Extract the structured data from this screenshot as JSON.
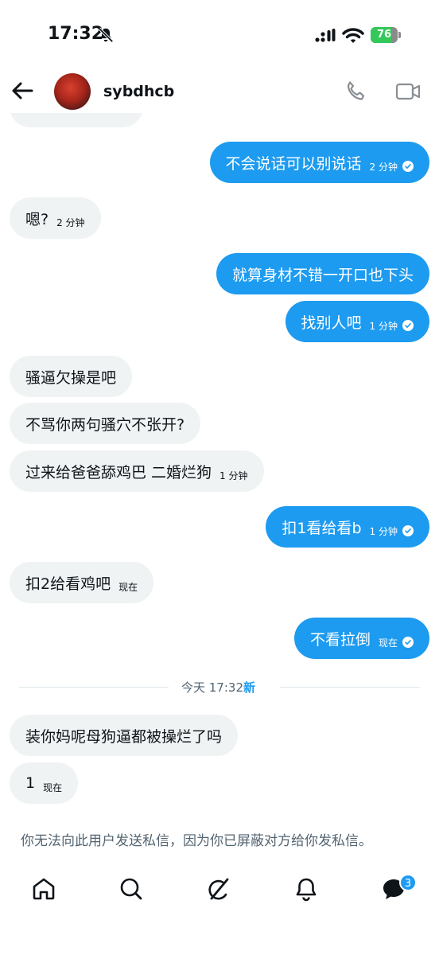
{
  "status": {
    "time": "17:32",
    "battery": "76"
  },
  "header": {
    "username": "sybdhcb"
  },
  "messages": [
    {
      "side": "right",
      "text": "不会说话可以别说话",
      "time": "2 分钟",
      "read": true
    },
    {
      "side": "left",
      "text": "嗯?",
      "time": "2 分钟"
    },
    {
      "side": "right",
      "text": "就算身材不错一开口也下头",
      "time": "",
      "read": false
    },
    {
      "side": "right",
      "text": "找别人吧",
      "time": "1 分钟",
      "read": true
    },
    {
      "side": "left",
      "text": "骚逼欠操是吧",
      "time": ""
    },
    {
      "side": "left",
      "text": "不骂你两句骚穴不张开?",
      "time": ""
    },
    {
      "side": "left",
      "text": "过来给爸爸舔鸡巴 二婚烂狗",
      "time": "1 分钟"
    },
    {
      "side": "right",
      "text": "扣1看给看b",
      "time": "1 分钟",
      "read": true
    },
    {
      "side": "left",
      "text": "扣2给看鸡吧",
      "time": "现在"
    },
    {
      "side": "right",
      "text": "不看拉倒",
      "time": "现在",
      "read": true
    },
    {
      "side": "left",
      "text": "装你妈呢母狗逼都被操烂了吗",
      "time": ""
    },
    {
      "side": "left",
      "text": "1",
      "time": "现在"
    }
  ],
  "divider": {
    "label": "今天 17:32",
    "new_label": "新"
  },
  "notice": "你无法向此用户发送私信，因为你已屏蔽对方给你发私信。",
  "tabbar": {
    "items": [
      "home-icon",
      "search-icon",
      "grok-icon",
      "notifications-icon",
      "messages-icon"
    ],
    "messages_badge": "3"
  },
  "colors": {
    "accent": "#1d9bf0",
    "bubble_left": "#eff3f4",
    "muted": "#536471"
  }
}
